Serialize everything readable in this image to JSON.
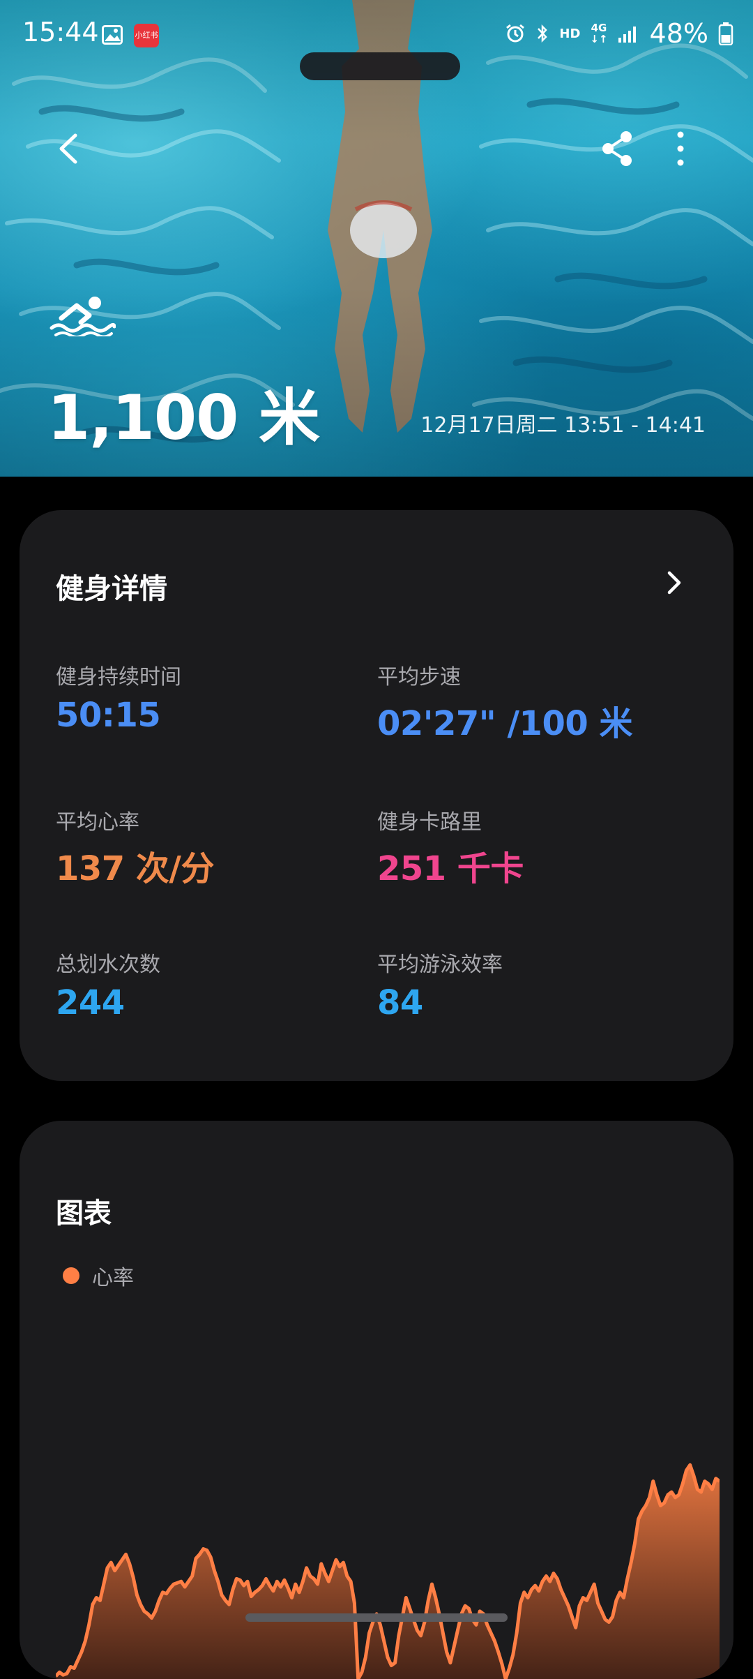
{
  "status_bar": {
    "time": "15:44",
    "app_badge": "小红书",
    "network_hd": "HD",
    "network_type": "4G",
    "battery": "48%"
  },
  "hero": {
    "distance": "1,100 米",
    "date_range": "12月17日周二 13:51 - 14:41",
    "icons": [
      "back-icon",
      "share-icon",
      "more-icon",
      "swimming-icon"
    ]
  },
  "details": {
    "title": "健身详情",
    "metrics": [
      {
        "label": "健身持续时间",
        "value": "50:15",
        "color": "#4b8ef5"
      },
      {
        "label": "平均步速",
        "value": "02'27\" /100 米",
        "color": "#4b8ef5"
      },
      {
        "label": "平均心率",
        "value": "137 次/分",
        "color": "#f08a4b"
      },
      {
        "label": "健身卡路里",
        "value": "251 千卡",
        "color": "#f0458e"
      },
      {
        "label": "总划水次数",
        "value": "244",
        "color": "#2ea6f0"
      },
      {
        "label": "平均游泳效率",
        "value": "84",
        "color": "#2ea6f0"
      }
    ]
  },
  "chart": {
    "title": "图表",
    "legend_label": "心率",
    "legend_color": "#ff7f45"
  },
  "chart_data": {
    "type": "area",
    "series": [
      {
        "name": "心率",
        "color": "#ff7f45",
        "values": [
          2,
          5,
          3,
          4,
          9,
          8,
          14,
          20,
          28,
          40,
          55,
          60,
          58,
          70,
          82,
          86,
          80,
          84,
          88,
          92,
          85,
          75,
          62,
          55,
          50,
          48,
          45,
          50,
          58,
          64,
          63,
          67,
          70,
          71,
          72,
          68,
          72,
          76,
          89,
          92,
          96,
          95,
          90,
          80,
          72,
          62,
          58,
          55,
          66,
          74,
          73,
          69,
          72,
          61,
          64,
          66,
          69,
          74,
          69,
          65,
          72,
          68,
          73,
          67,
          60,
          70,
          64,
          72,
          82,
          76,
          74,
          70,
          85,
          78,
          72,
          80,
          88,
          83,
          86,
          76,
          72,
          56,
          0,
          5,
          16,
          34,
          42,
          48,
          40,
          28,
          16,
          10,
          12,
          32,
          46,
          60,
          52,
          44,
          36,
          32,
          42,
          58,
          70,
          60,
          48,
          34,
          20,
          12,
          24,
          36,
          48,
          54,
          52,
          44,
          40,
          50,
          48,
          40,
          34,
          28,
          20,
          11,
          0,
          8,
          18,
          34,
          56,
          64,
          60,
          66,
          69,
          65,
          72,
          76,
          72,
          78,
          74,
          66,
          60,
          54,
          46,
          38,
          54,
          60,
          58,
          64,
          70,
          56,
          50,
          44,
          42,
          46,
          58,
          64,
          60,
          74,
          86,
          100,
          118,
          124,
          128,
          134,
          146,
          136,
          128,
          130,
          136,
          138,
          134,
          136,
          144,
          154,
          158,
          150,
          140,
          138,
          146,
          144,
          140,
          148,
          146
        ]
      }
    ],
    "ylim": [
      0,
      170
    ],
    "grid": false,
    "legend": "top-left"
  }
}
